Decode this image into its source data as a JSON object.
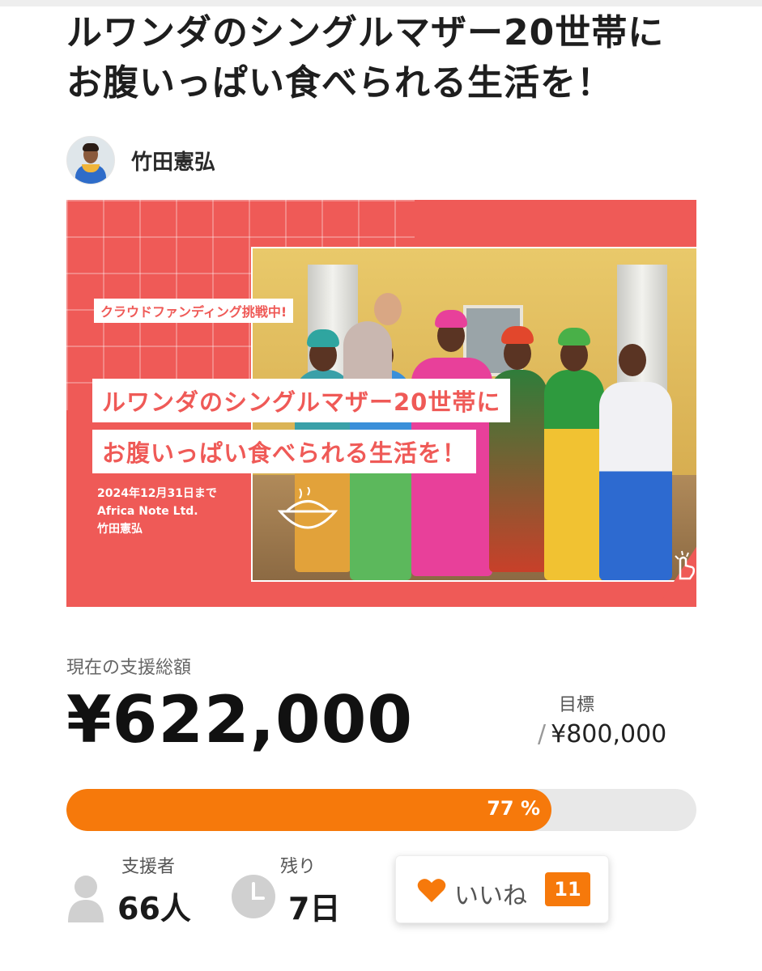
{
  "project": {
    "title_line1": "ルワンダのシングルマザー20世帯に",
    "title_line2": "お腹いっぱい食べられる生活を！",
    "owner_name": "竹田憲弘"
  },
  "hero": {
    "badge": "クラウドファンディング挑戦中!",
    "headline1": "ルワンダのシングルマザー20世帯に",
    "headline2": "お腹いっぱい食べられる生活を！",
    "deadline": "2024年12月31日まで",
    "company": "Africa Note Ltd.",
    "owner": "竹田憲弘"
  },
  "funding": {
    "amount_label": "現在の支援総額",
    "amount": "¥622,000",
    "goal_label": "目標",
    "goal_slash": "/",
    "goal": "¥800,000",
    "progress_percent": 77,
    "progress_text": "77 %"
  },
  "stats": {
    "supporters_label": "支援者",
    "supporters_value": "66人",
    "remaining_label": "残り",
    "remaining_value": "7日"
  },
  "like": {
    "label": "いいね",
    "count": "11"
  },
  "colors": {
    "accent": "#f6790b",
    "hero_bg": "#ef5a57",
    "progress_track": "#e8e8e8"
  },
  "icons": [
    "person-icon",
    "clock-icon",
    "heart-icon",
    "bowl-icon",
    "hand-pointer-icon"
  ]
}
